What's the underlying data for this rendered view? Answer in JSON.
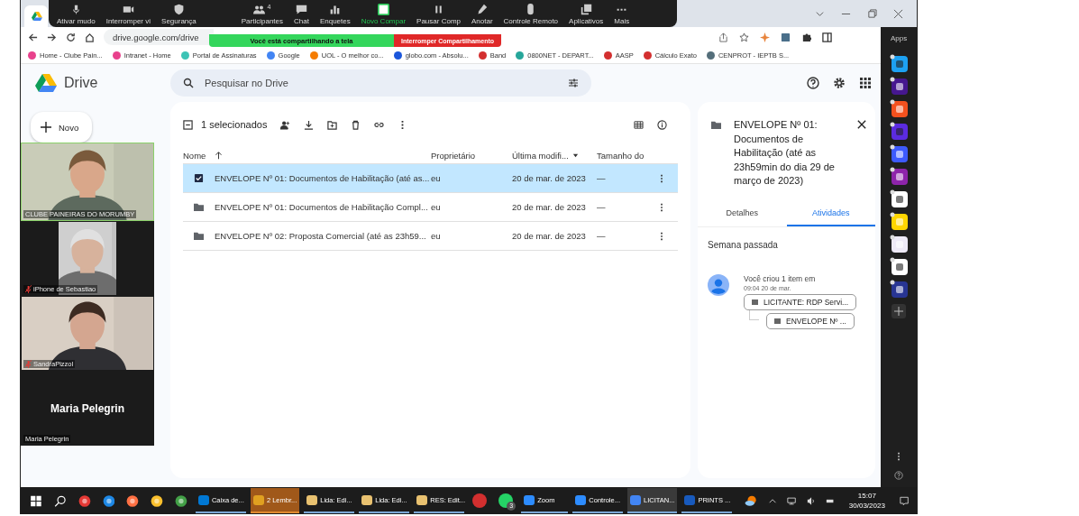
{
  "zoom_toolbar": {
    "buttons": [
      {
        "label": "Ativar mudo",
        "highlighted": false
      },
      {
        "label": "Interromper vi",
        "highlighted": false
      },
      {
        "label": "Segurança",
        "highlighted": false
      },
      {
        "label": "Participantes",
        "count": "4",
        "highlighted": false
      },
      {
        "label": "Chat",
        "highlighted": false
      },
      {
        "label": "Enquetes",
        "highlighted": false
      },
      {
        "label": "Novo Compar",
        "highlighted": true
      },
      {
        "label": "Pausar Comp",
        "highlighted": false
      },
      {
        "label": "Anotar",
        "highlighted": false
      },
      {
        "label": "Controle Remoto",
        "highlighted": false
      },
      {
        "label": "Aplicativos",
        "highlighted": false
      },
      {
        "label": "Mais",
        "highlighted": false
      }
    ]
  },
  "sharing_banner": {
    "text": "Você está compartilhando a tela",
    "stop_button": "Interromper Compartilhamento"
  },
  "browser": {
    "address": "drive.google.com/drive",
    "bookmarks": [
      "Home - Clube Pain...",
      "Intranet - Home",
      "Portal de Assinaturas",
      "Google",
      "UOL - O melhor co...",
      "globo.com - Absolu...",
      "Band",
      "0800NET - DEPART...",
      "AASP",
      "Cálculo Exato",
      "CENPROT - IEPTB S..."
    ]
  },
  "apps_sidebar": {
    "title": "Apps"
  },
  "drive": {
    "brand": "Drive",
    "search": {
      "placeholder": "Pesquisar no Drive"
    },
    "new_button": "Novo",
    "selection": "1 selecionados",
    "columns": [
      "Nome",
      "Proprietário",
      "Última modifi...",
      "Tamanho do"
    ],
    "rows": [
      {
        "name": "ENVELOPE Nº 01: Documentos de Habilitação (até as...",
        "owner": "eu",
        "modified": "20 de mar. de 2023",
        "size": "—",
        "selected": true
      },
      {
        "name": "ENVELOPE Nº 01: Documentos de Habilitação Compl...",
        "owner": "eu",
        "modified": "20 de mar. de 2023",
        "size": "—",
        "selected": false
      },
      {
        "name": "ENVELOPE Nº 02: Proposta Comercial (até as 23h59...",
        "owner": "eu",
        "modified": "20 de mar. de 2023",
        "size": "—",
        "selected": false
      }
    ],
    "details": {
      "title": "ENVELOPE Nº 01: Documentos de Habilitação (até as 23h59min do dia 29 de março de 2023)",
      "tabs": [
        {
          "label": "Detalhes",
          "selected": false
        },
        {
          "label": "Atividades",
          "selected": true
        }
      ],
      "section": "Semana passada",
      "activity": {
        "text": "Você criou 1 item em",
        "time": "09:04 20 de mar.",
        "parent": "LICITANTE: RDP Servi...",
        "child": "ENVELOPE Nº ..."
      }
    }
  },
  "video_tiles": [
    {
      "kind": "video",
      "name": "CLUBE PAINEIRAS DO MORUMBY",
      "muted": false,
      "active": true
    },
    {
      "kind": "video",
      "name": "iPhone de Sebastiao",
      "muted": true,
      "active": false
    },
    {
      "kind": "video",
      "name": "SandraPizzol",
      "muted": true,
      "active": false
    },
    {
      "kind": "name",
      "display": "Maria Pelegrin",
      "name": "Maria Pelegrin",
      "muted": false,
      "active": false
    }
  ],
  "taskbar": {
    "items": [
      {
        "kind": "labeled",
        "label": "Caixa de...",
        "alert": false,
        "selected": false
      },
      {
        "kind": "labeled",
        "label": "2 Lembr...",
        "alert": true,
        "selected": false
      },
      {
        "kind": "labeled",
        "label": "Lida: Edi...",
        "alert": false,
        "selected": false
      },
      {
        "kind": "labeled",
        "label": "Lida: Edi...",
        "alert": false,
        "selected": false
      },
      {
        "kind": "labeled",
        "label": "RES: Edit...",
        "alert": false,
        "selected": false
      },
      {
        "kind": "icon",
        "alert": false,
        "selected": false
      },
      {
        "kind": "icon",
        "badge": "3",
        "alert": false,
        "selected": false
      },
      {
        "kind": "labeled",
        "label": "Zoom",
        "alert": false,
        "selected": false
      },
      {
        "kind": "labeled",
        "label": "Controle...",
        "alert": false,
        "selected": false
      },
      {
        "kind": "labeled",
        "label": "LICITAN...",
        "alert": false,
        "selected": true
      },
      {
        "kind": "labeled",
        "label": "PRINTS ...",
        "alert": false,
        "selected": false
      }
    ],
    "time": "15:07",
    "date": "30/03/2023"
  }
}
